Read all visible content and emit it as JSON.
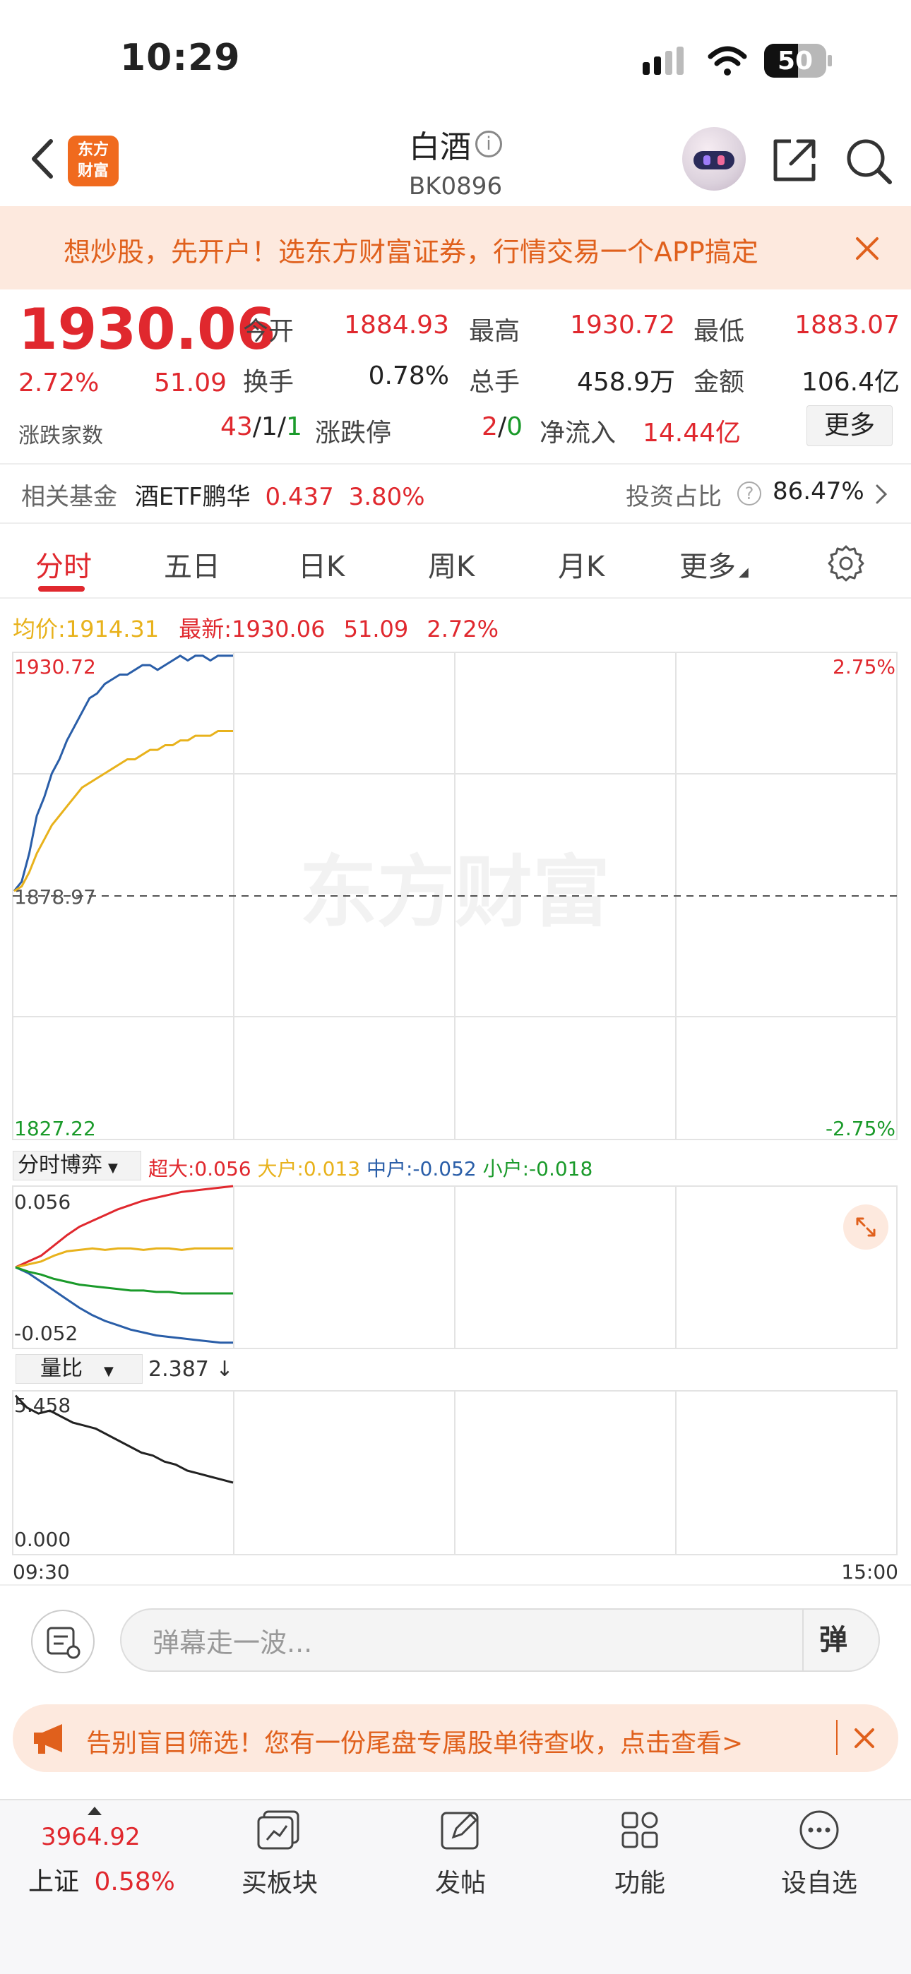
{
  "status_bar": {
    "time": "10:29",
    "battery": "50"
  },
  "nav": {
    "logo_line1": "东方",
    "logo_line2": "财富",
    "title": "白酒",
    "code": "BK0896"
  },
  "banner": {
    "text": "想炒股，先开户！选东方财富证券，行情交易一个APP搞定"
  },
  "quote": {
    "price": "1930.06",
    "pct": "2.72%",
    "change": "51.09",
    "open_label": "今开",
    "open": "1884.93",
    "high_label": "最高",
    "high": "1930.72",
    "low_label": "最低",
    "low": "1883.07",
    "turnover_label": "换手",
    "turnover": "0.78%",
    "volume_label": "总手",
    "volume": "458.9万",
    "amount_label": "金额",
    "amount": "106.4亿",
    "adv_label": "涨跌家数",
    "adv_up": "43",
    "adv_flat": "1",
    "adv_down": "1",
    "limit_label": "涨跌停",
    "limit_up": "2",
    "limit_down": "0",
    "inflow_label": "净流入",
    "inflow": "14.44亿",
    "more": "更多"
  },
  "fund": {
    "label": "相关基金",
    "name": "酒ETF鹏华",
    "price": "0.437",
    "pct": "3.80%",
    "ratio_label": "投资占比",
    "ratio": "86.47%"
  },
  "tabs": [
    "分时",
    "五日",
    "日K",
    "周K",
    "月K",
    "更多"
  ],
  "info": {
    "avg_label": "均价:",
    "avg": "1914.31",
    "latest_label": "最新:",
    "latest": "1930.06",
    "chg": "51.09",
    "pct": "2.72%"
  },
  "chart_data": [
    {
      "type": "line",
      "title": "",
      "y_range": [
        1827.22,
        1930.72
      ],
      "base": "1878.97",
      "top_label": "1930.72",
      "bottom_label": "1827.22",
      "right_top": "2.75%",
      "right_bottom": "-2.75%",
      "watermark": "东方财富",
      "series": [
        {
          "values": [
            1880,
            1882,
            1888,
            1896,
            1900,
            1905,
            1908,
            1912,
            1915,
            1918,
            1921,
            1922,
            1924,
            1925,
            1926,
            1926,
            1927,
            1928,
            1928,
            1927,
            1928,
            1929,
            1930,
            1929,
            1930,
            1930,
            1929,
            1930,
            1930,
            1930
          ]
        },
        {
          "values": [
            1880,
            1881,
            1884,
            1888,
            1891,
            1894,
            1896,
            1898,
            1900,
            1902,
            1903,
            1904,
            1905,
            1906,
            1907,
            1908,
            1908,
            1909,
            1910,
            1910,
            1911,
            1911,
            1912,
            1912,
            1913,
            1913,
            1913,
            1914,
            1914,
            1914
          ]
        }
      ]
    },
    {
      "type": "line",
      "title": "分时博弈",
      "y_range": [
        -0.056,
        0.056
      ],
      "top_label": "0.056",
      "bottom_label": "-0.052",
      "series": [
        {
          "name": "超大:0.056",
          "values": [
            0,
            0.004,
            0.008,
            0.015,
            0.022,
            0.028,
            0.032,
            0.036,
            0.04,
            0.043,
            0.046,
            0.048,
            0.05,
            0.052,
            0.053,
            0.054,
            0.055,
            0.056
          ]
        },
        {
          "name": "大户:0.013",
          "values": [
            0,
            0.002,
            0.004,
            0.008,
            0.011,
            0.012,
            0.013,
            0.012,
            0.013,
            0.013,
            0.012,
            0.013,
            0.013,
            0.012,
            0.013,
            0.013,
            0.013,
            0.013
          ]
        },
        {
          "name": "中户:-0.052",
          "values": [
            0,
            -0.004,
            -0.01,
            -0.016,
            -0.022,
            -0.028,
            -0.033,
            -0.037,
            -0.04,
            -0.043,
            -0.045,
            -0.047,
            -0.048,
            -0.049,
            -0.05,
            -0.051,
            -0.052,
            -0.052
          ]
        },
        {
          "name": "小户:-0.018",
          "values": [
            0,
            -0.003,
            -0.005,
            -0.008,
            -0.01,
            -0.012,
            -0.013,
            -0.014,
            -0.015,
            -0.016,
            -0.016,
            -0.017,
            -0.017,
            -0.018,
            -0.018,
            -0.018,
            -0.018,
            -0.018
          ]
        }
      ]
    },
    {
      "type": "line",
      "title": "量比",
      "value": "2.387",
      "y_range": [
        0,
        5.458
      ],
      "top_label": "5.458",
      "bottom_label": "0.000",
      "x_labels": [
        "09:30",
        "15:00"
      ],
      "series": [
        {
          "values": [
            5.3,
            4.9,
            4.7,
            4.8,
            4.6,
            4.4,
            4.3,
            4.2,
            4.0,
            3.8,
            3.6,
            3.4,
            3.3,
            3.1,
            3.0,
            2.8,
            2.7,
            2.6,
            2.5,
            2.4
          ]
        }
      ]
    }
  ],
  "danmu": {
    "placeholder": "弹幕走一波...",
    "button": "弹"
  },
  "promo": {
    "text": "告别盲目筛选！您有一份尾盘专属股单待查收，点击查看>"
  },
  "tabbar": {
    "index_value": "3964.92",
    "index_name": "上证",
    "index_pct": "0.58%",
    "items": [
      "买板块",
      "发帖",
      "功能",
      "设自选"
    ]
  },
  "colors": {
    "red": "#e0282e",
    "green": "#1a9a2a",
    "orange": "#e8731c",
    "blue": "#2a5ea8",
    "gold": "#e8b21c"
  }
}
